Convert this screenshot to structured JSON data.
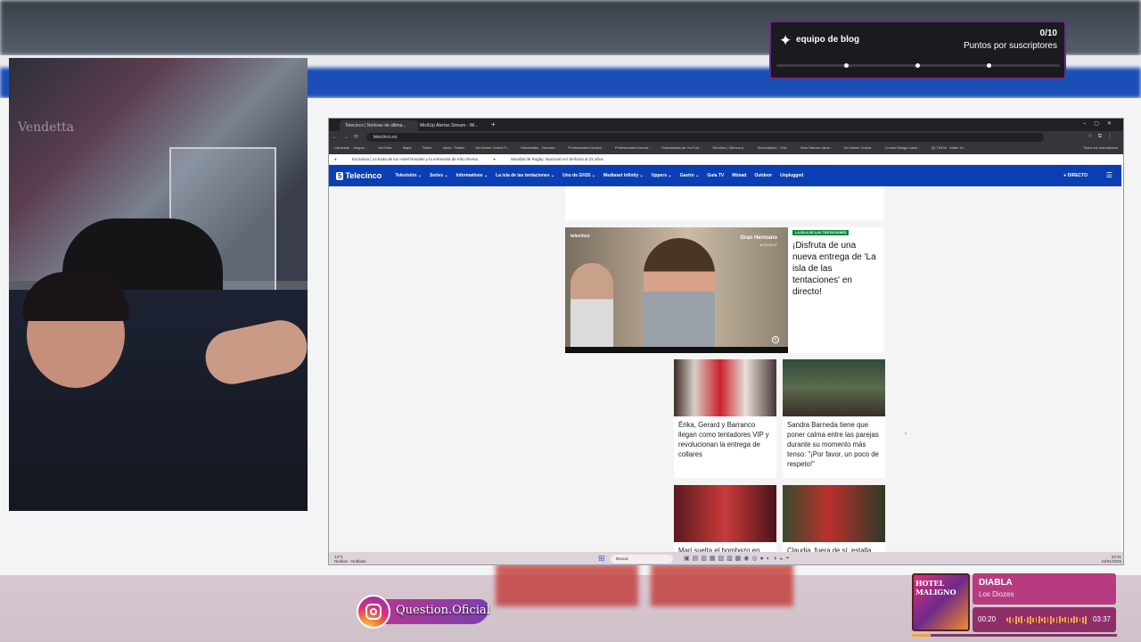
{
  "alert": {
    "title": "equipo de blog",
    "count": "0/10",
    "subtitle": "Puntos por suscriptores",
    "icon": "star-icon"
  },
  "browser": {
    "tabs": [
      {
        "label": "Telecinco | Noticias de última..."
      },
      {
        "label": "MixItUp Alertas Stream - Wi..."
      }
    ],
    "url": "telecinco.es",
    "bookmarks": [
      "Gameball - Juegos...",
      "YouTube",
      "Maps",
      "Twitch",
      "Inicio / Twitter",
      "Ver Anime Online Fr...",
      "Streamlabs - Devices...",
      "Profesionales Asocia...",
      "Profesionales Asocia...",
      "Estadísticas de YouTub...",
      "Servidor | Últimos p...",
      "Subscription - Onli...",
      "Jhon Ramos Jame...",
      "Ver Anime Online...",
      "Cursos Manga Lacio...",
      "(3) TikTok - Make Yo..."
    ],
    "bookmarks_extra": "Todos los marcadores",
    "ticker": [
      "Exclusiva | La boda de los Hotel Rosales y la entrevista de Kiko Rivera",
      "Mundial de Rugby: Nacional Así Sinfonía al 22 años"
    ]
  },
  "site": {
    "logo_number": "5",
    "logo_text": "Telecinco",
    "nav": [
      "Televisión ⌄",
      "Series ⌄",
      "Informativos ⌄",
      "La isla de las tentaciones ⌄",
      "Uno de GH20 ⌄",
      "Mediaset Infinity ⌄",
      "Uppers ⌄",
      "Gastro ⌄",
      "Guía TV",
      "Mtmad",
      "Outdoor",
      "Unplugged"
    ],
    "directo": "● DIRECTO"
  },
  "feature": {
    "tag": "LA ISLA DE LAS TENTACIONES",
    "title": "¡Disfruta de una nueva entrega de 'La isla de las tentaciones' en directo!",
    "video_label": "Gran Hermano",
    "video_time": "● 22:33:37",
    "video_channel": "telecinco"
  },
  "cards": [
    {
      "caption": "Érika, Gerard y Barranco llegan como tentadores VIP y revolucionan la entrega de collares"
    },
    {
      "caption": "Sandra Barneda tiene que poner calma entre las parejas durante su momento más tenso: \"¡Por favor, un poco de respeto!\""
    },
    {
      "caption": "Mari suelta el bombazo en..."
    },
    {
      "caption": "Claudia, fuera de sí, estalla..."
    }
  ],
  "taskbar": {
    "weather": "14°C\nNieblas - Nublado",
    "search": "Buscar",
    "time": "22:41\n23/01/2025"
  },
  "instagram": {
    "handle": "Question.Oficial"
  },
  "music": {
    "album_text": "HOTEL MALIGNO",
    "title": "DIABLA",
    "artist": "Los Diozes",
    "current": "00:20",
    "total": "03:37",
    "progress_fraction": 0.09,
    "accent": "#f2a23c"
  },
  "webcam": {
    "watermark": "Vendetta"
  }
}
